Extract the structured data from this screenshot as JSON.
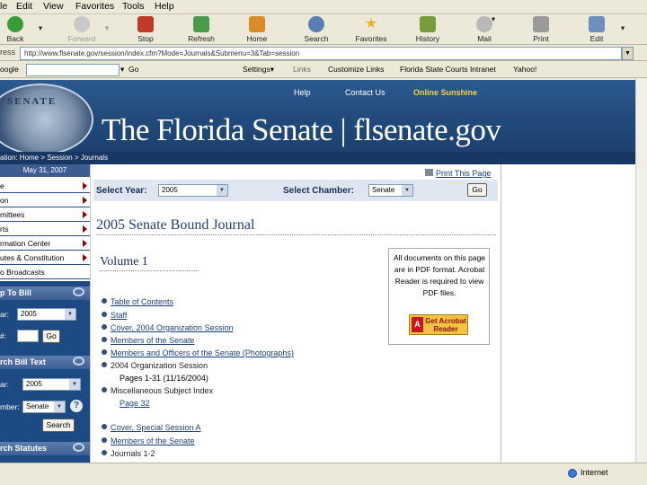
{
  "menu": [
    "le",
    "Edit",
    "View",
    "Favorites",
    "Tools",
    "Help"
  ],
  "toolbar": {
    "back": "Back",
    "forward": "Forward",
    "stop": "Stop",
    "refresh": "Refresh",
    "home": "Home",
    "search": "Search",
    "favorites": "Favorites",
    "history": "History",
    "mail": "Mail",
    "print": "Print",
    "edit": "Edit"
  },
  "address": {
    "label": "ress",
    "url": "http://www.flsenate.gov/session/index.cfm?Mode=Journals&Submenu=3&Tab=session"
  },
  "google_bar": {
    "label": "oogle",
    "go": "Go",
    "settings": "Settings▾",
    "links": "Links",
    "customize_links": "Customize Links",
    "florida_courts": "Florida State Courts Intranet",
    "yahoo": "Yahoo!"
  },
  "banner": {
    "help": "Help",
    "contact": "Contact Us",
    "sunshine": "Online Sunshine",
    "seal": "SENATE",
    "title": "The Florida Senate | flsenate.gov",
    "breadcrumb": "ation:  Home  > Session  > Journals"
  },
  "sidebar": {
    "date": "May 31, 2007",
    "items": [
      "e",
      "on",
      "mittees",
      "rts",
      "rmation Center",
      "utes & Constitution",
      "o Broadcasts"
    ],
    "jump_to_bill": {
      "head": "p To Bill",
      "year_label": "ar:",
      "year": "2005",
      "bill_label": "#:",
      "go": "Go"
    },
    "search_bill_text": {
      "head": "rch Bill Text",
      "year_label": "ar:",
      "year": "2005",
      "chamber_label": "mber:",
      "chamber": "Senate",
      "help": "?",
      "search": "Search"
    },
    "search_statutes": {
      "head": "rch Statutes"
    }
  },
  "content": {
    "print": "Print This Page",
    "select_year_label": "Select Year:",
    "year": "2005",
    "select_chamber_label": "Select Chamber:",
    "chamber": "Senate",
    "go": "Go",
    "journal_title": "2005 Senate Bound Journal",
    "volume": "Volume 1",
    "pdf_note": "All documents on this page are in PDF format. Acrobat Reader is required to view PDF files.",
    "acrobat_a": "A",
    "acrobat_text": "Get Acrobat Reader",
    "list": [
      {
        "text": "Table of Contents",
        "link": true
      },
      {
        "text": "Staff",
        "link": true
      },
      {
        "text": "Cover, 2004 Organization Session",
        "link": true
      },
      {
        "text": "Members of the Senate",
        "link": true
      },
      {
        "text": "Members and Officers of the Senate (Photographs)",
        "link": true
      },
      {
        "text": "2004 Organization Session",
        "link": false
      },
      {
        "text": "Miscellaneous Subject Index",
        "link": false
      },
      {
        "text": "Cover, Special Session A",
        "link": true
      },
      {
        "text": "Members of the Senate",
        "link": true
      },
      {
        "text": "Journals 1-2",
        "link": false
      }
    ],
    "sub_pages_1": "Pages 1-31 (11/16/2004)",
    "sub_pages_2": "Page 32"
  },
  "status": {
    "zone": "Internet"
  }
}
